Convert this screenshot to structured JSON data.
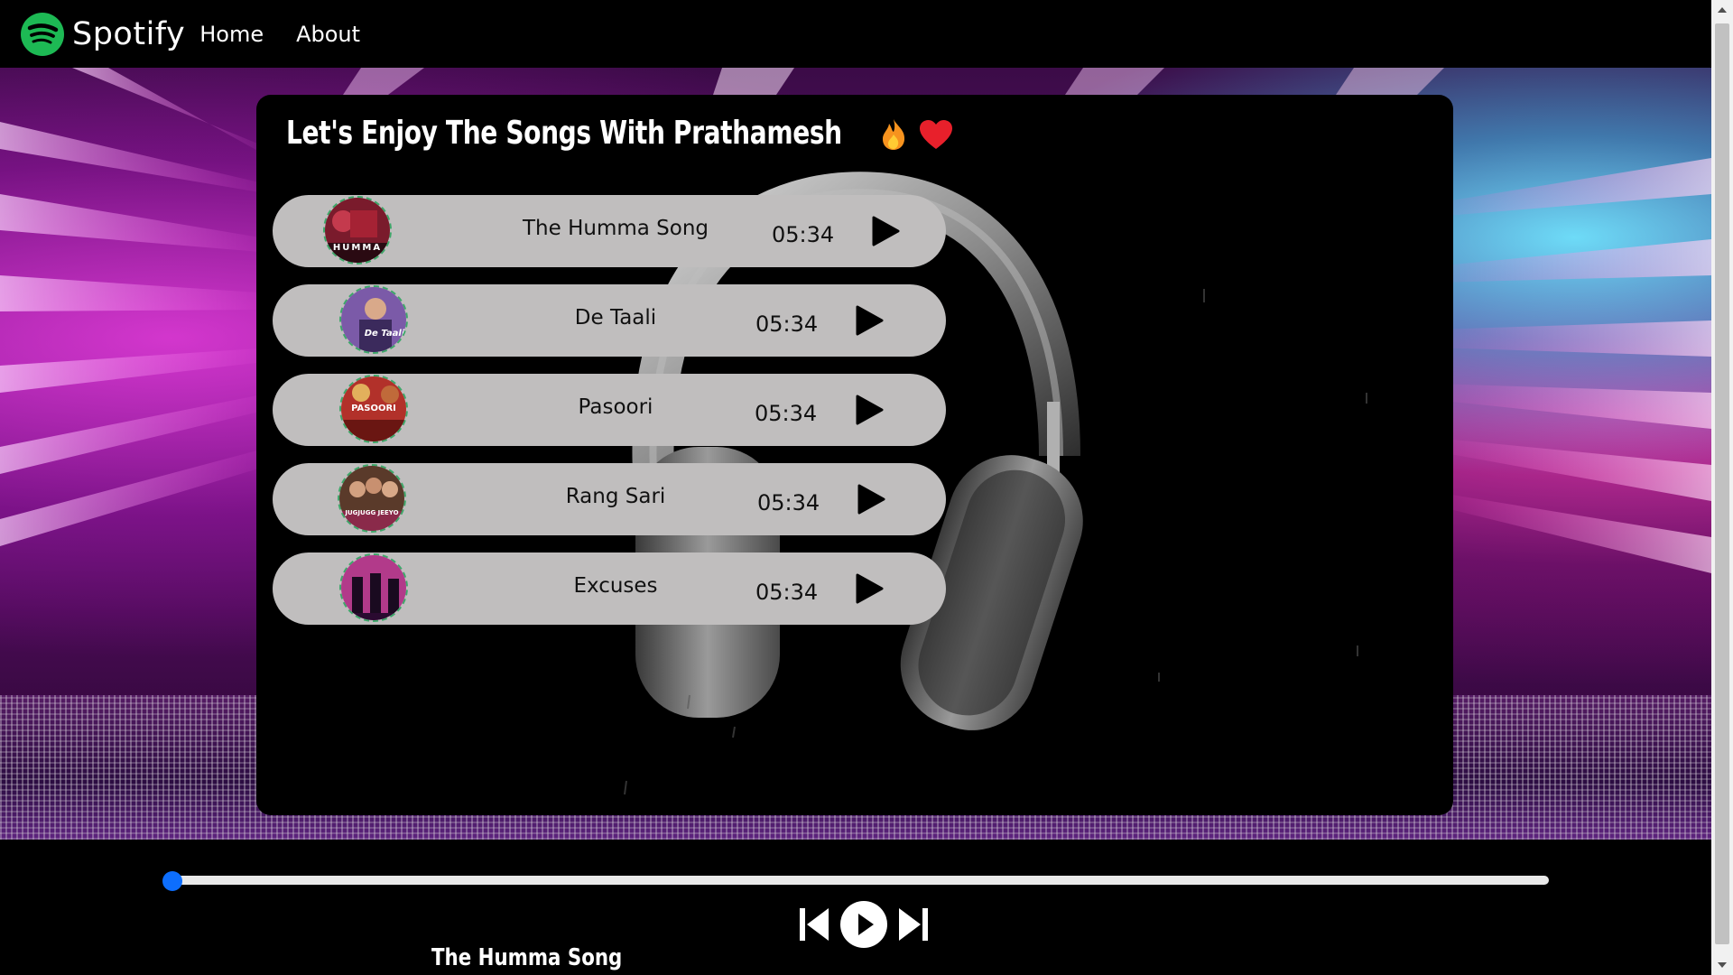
{
  "nav": {
    "brand": "Spotify",
    "links": [
      "Home",
      "About"
    ]
  },
  "card": {
    "title": "Let's Enjoy The Songs With Prathamesh",
    "icons": [
      "fire-icon",
      "heart-icon"
    ]
  },
  "songs": [
    {
      "name": "The Humma Song",
      "duration": "05:34",
      "cover_text": "HUMMA"
    },
    {
      "name": "De Taali",
      "duration": "05:34",
      "cover_text": "De Taali"
    },
    {
      "name": "Pasoori",
      "duration": "05:34",
      "cover_text": "PASOORI"
    },
    {
      "name": "Rang Sari",
      "duration": "05:34",
      "cover_text": "JUGJUGG JEEYO"
    },
    {
      "name": "Excuses",
      "duration": "05:34",
      "cover_text": ""
    }
  ],
  "player": {
    "now_playing": "The Humma Song",
    "progress": 0,
    "controls": [
      "previous-icon",
      "play-circle-icon",
      "next-icon"
    ]
  },
  "colors": {
    "brand_green": "#1DB954",
    "song_item_bg": "#c0bebe",
    "progress_thumb": "#0d6efd",
    "card_bg": "#000000"
  }
}
